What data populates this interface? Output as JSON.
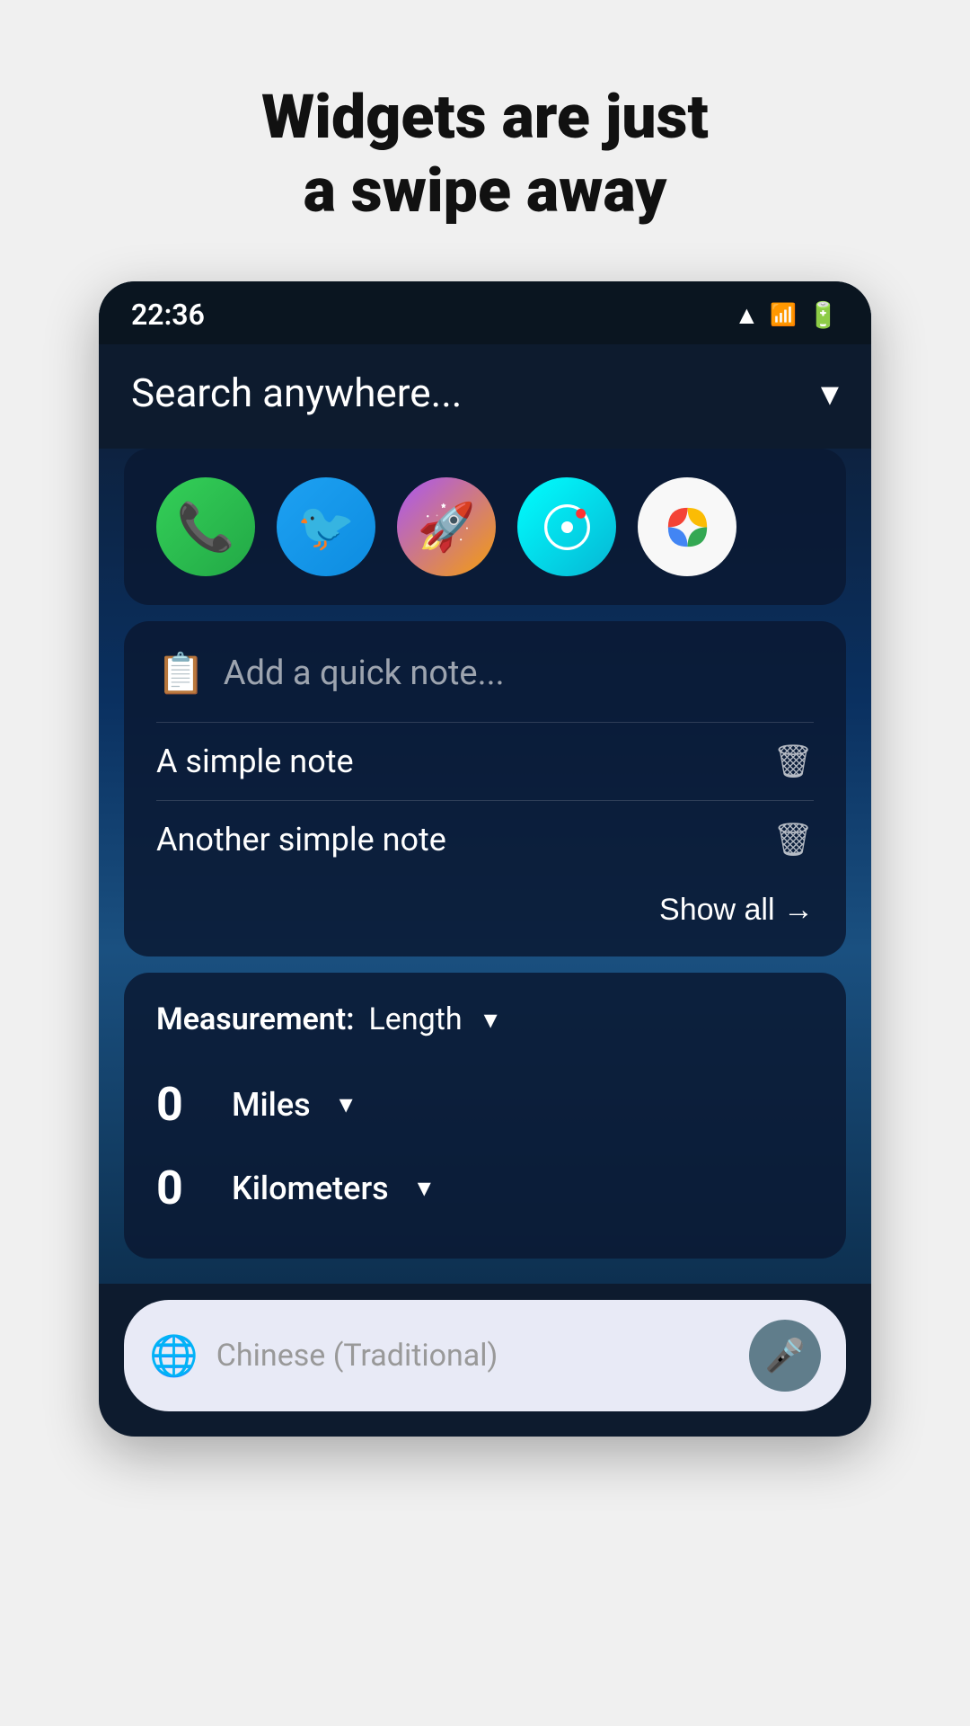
{
  "header": {
    "title_line1": "Widgets are just",
    "title_line2": "a swipe away"
  },
  "status_bar": {
    "time": "22:36"
  },
  "search": {
    "placeholder": "Search anywhere...",
    "chevron": "▾"
  },
  "apps": {
    "icons": [
      "phone",
      "twitter",
      "rocket",
      "camera",
      "photos"
    ]
  },
  "notes_widget": {
    "add_placeholder": "Add a quick note...",
    "notes": [
      {
        "text": "A simple note"
      },
      {
        "text": "Another simple note"
      }
    ],
    "show_all_label": "Show all →"
  },
  "measurement_widget": {
    "label": "Measurement:",
    "type": "Length",
    "rows": [
      {
        "value": "0",
        "unit": "Miles"
      },
      {
        "value": "0",
        "unit": "Kilometers"
      }
    ]
  },
  "translate_bar": {
    "placeholder": "Chinese (Traditional)"
  }
}
